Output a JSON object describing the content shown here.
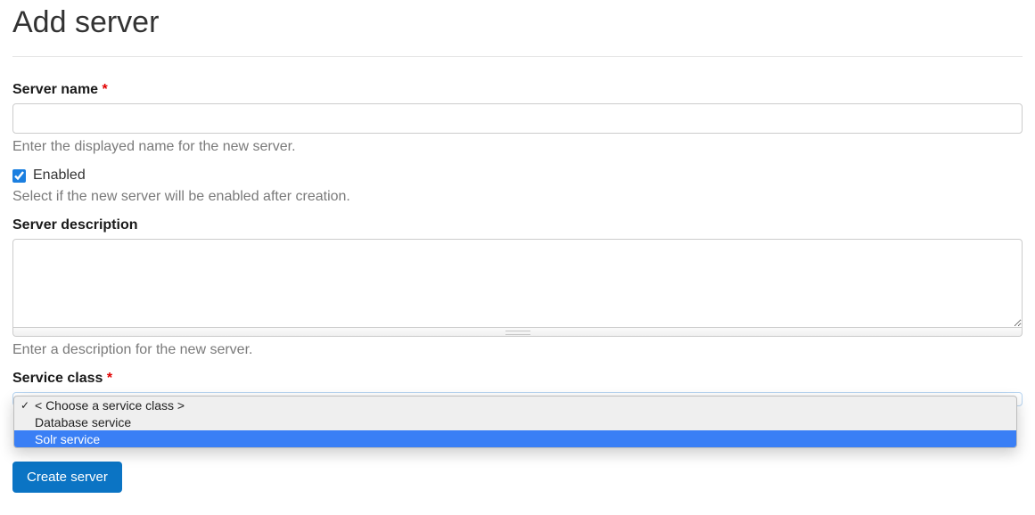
{
  "page": {
    "title": "Add server"
  },
  "form": {
    "server_name": {
      "label": "Server name",
      "required_mark": "*",
      "value": "",
      "help": "Enter the displayed name for the new server."
    },
    "enabled": {
      "label": "Enabled",
      "checked": true,
      "help": "Select if the new server will be enabled after creation."
    },
    "server_description": {
      "label": "Server description",
      "value": "",
      "help": "Enter a description for the new server."
    },
    "service_class": {
      "label": "Service class",
      "required_mark": "*",
      "selected_index": 0,
      "highlighted_index": 2,
      "options": [
        "< Choose a service class >",
        "Database service",
        "Solr service"
      ]
    },
    "submit_label": "Create server"
  }
}
